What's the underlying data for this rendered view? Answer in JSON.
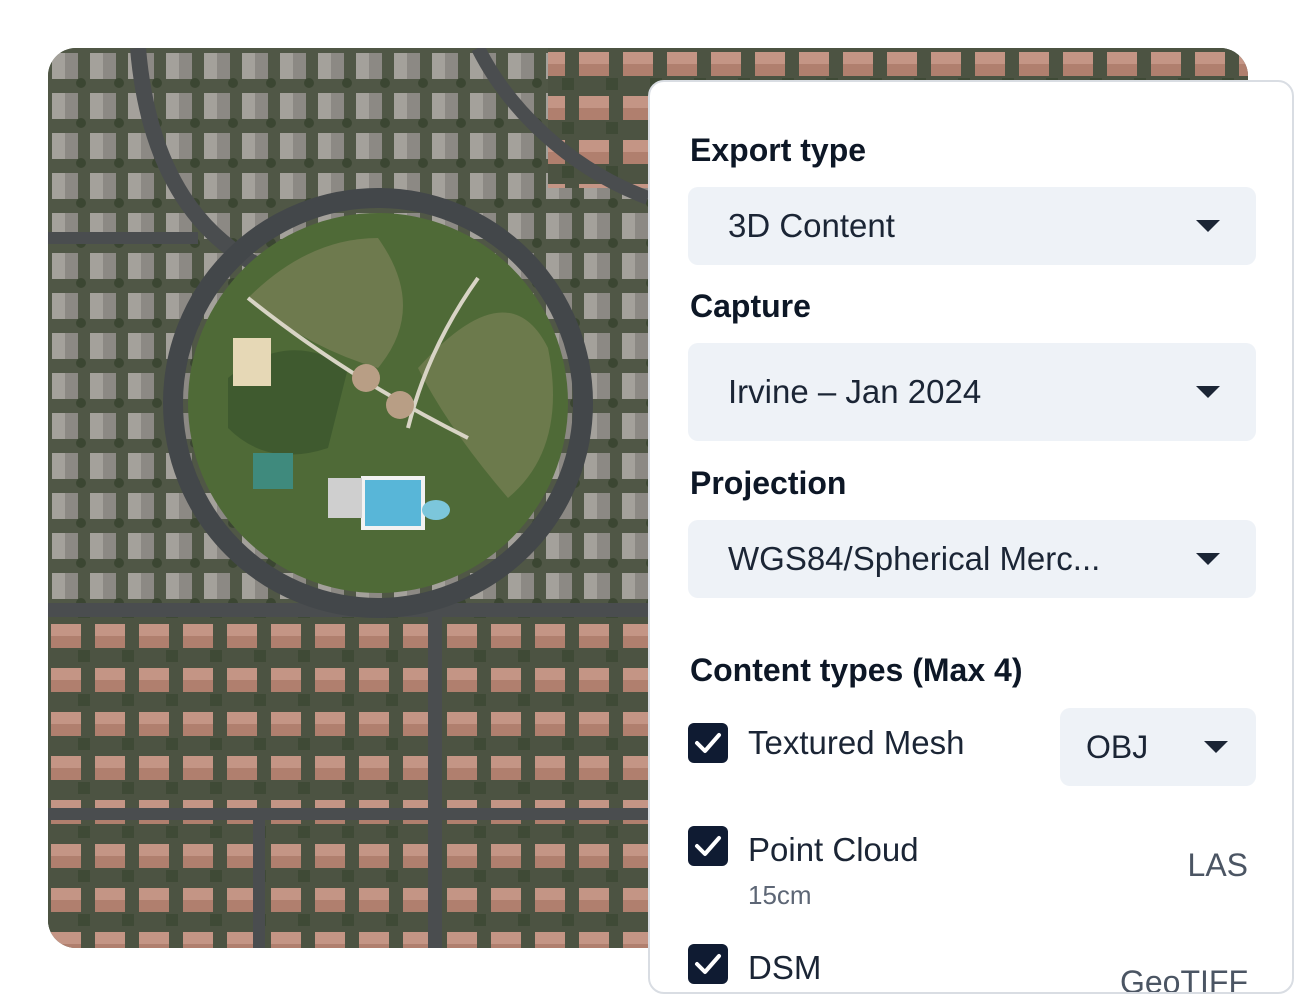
{
  "map": {
    "alt": "Aerial satellite view of a circular park surrounded by houses"
  },
  "panel": {
    "export_type": {
      "label": "Export type",
      "value": "3D Content"
    },
    "capture": {
      "label": "Capture",
      "value": "Irvine – Jan 2024"
    },
    "projection": {
      "label": "Projection",
      "value": "WGS84/Spherical Merc..."
    },
    "content_types": {
      "label": "Content types (Max 4)",
      "items": [
        {
          "label": "Textured Mesh",
          "sublabel": "",
          "checked": true,
          "format": "OBJ",
          "format_is_select": true
        },
        {
          "label": "Point Cloud",
          "sublabel": "15cm",
          "checked": true,
          "format": "LAS",
          "format_is_select": false
        },
        {
          "label": "DSM",
          "sublabel": "",
          "checked": true,
          "format": "GeoTIFF",
          "format_is_select": false
        }
      ]
    }
  },
  "colors": {
    "checkbox": "#0f1b32",
    "select_bg": "#eef2f7",
    "panel_border": "#d9dde3"
  },
  "icons": {
    "dropdown": "chevron-down-icon",
    "check": "checkmark-icon"
  }
}
